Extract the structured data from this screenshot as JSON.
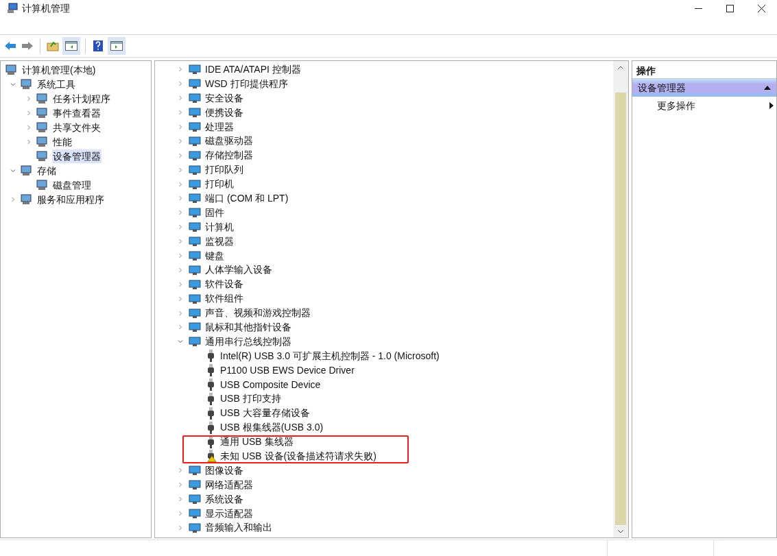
{
  "window": {
    "title": "计算机管理"
  },
  "nav_tree": [
    {
      "label": "计算机管理(本地)",
      "selected": false,
      "children": [
        {
          "label": "系统工具",
          "expanded": true,
          "selected": false,
          "children": [
            {
              "label": "任务计划程序",
              "expanded": false,
              "selected": false
            },
            {
              "label": "事件查看器",
              "expanded": false,
              "selected": false
            },
            {
              "label": "共享文件夹",
              "expanded": false,
              "selected": false
            },
            {
              "label": "性能",
              "expanded": false,
              "selected": false
            },
            {
              "label": "设备管理器",
              "selected": true
            }
          ]
        },
        {
          "label": "存储",
          "expanded": true,
          "selected": false,
          "children": [
            {
              "label": "磁盘管理",
              "selected": false
            }
          ]
        },
        {
          "label": "服务和应用程序",
          "expanded": false,
          "selected": false
        }
      ]
    }
  ],
  "device_tree": [
    {
      "label": "IDE ATA/ATAPI 控制器",
      "expanded": false
    },
    {
      "label": "WSD 打印提供程序",
      "expanded": false
    },
    {
      "label": "安全设备",
      "expanded": false
    },
    {
      "label": "便携设备",
      "expanded": false
    },
    {
      "label": "处理器",
      "expanded": false
    },
    {
      "label": "磁盘驱动器",
      "expanded": false
    },
    {
      "label": "存储控制器",
      "expanded": false
    },
    {
      "label": "打印队列",
      "expanded": false
    },
    {
      "label": "打印机",
      "expanded": false
    },
    {
      "label": "端口 (COM 和 LPT)",
      "expanded": false
    },
    {
      "label": "固件",
      "expanded": false
    },
    {
      "label": "计算机",
      "expanded": false
    },
    {
      "label": "监视器",
      "expanded": false
    },
    {
      "label": "键盘",
      "expanded": false
    },
    {
      "label": "人体学输入设备",
      "expanded": false
    },
    {
      "label": "软件设备",
      "expanded": false
    },
    {
      "label": "软件组件",
      "expanded": false
    },
    {
      "label": "声音、视频和游戏控制器",
      "expanded": false
    },
    {
      "label": "鼠标和其他指针设备",
      "expanded": false
    },
    {
      "label": "通用串行总线控制器",
      "expanded": true,
      "children": [
        {
          "label": "Intel(R) USB 3.0 可扩展主机控制器 - 1.0 (Microsoft)",
          "warning": false
        },
        {
          "label": "P1100 USB EWS Device Driver",
          "warning": false
        },
        {
          "label": "USB Composite Device",
          "warning": false
        },
        {
          "label": "USB 打印支持",
          "warning": false
        },
        {
          "label": "USB 大容量存储设备",
          "warning": false
        },
        {
          "label": "USB 根集线器(USB 3.0)",
          "warning": false
        },
        {
          "label": "通用 USB 集线器",
          "warning": false
        },
        {
          "label": "未知 USB 设备(设备描述符请求失败)",
          "warning": true
        }
      ]
    },
    {
      "label": "图像设备",
      "expanded": false
    },
    {
      "label": "网络适配器",
      "expanded": false
    },
    {
      "label": "系统设备",
      "expanded": false
    },
    {
      "label": "显示适配器",
      "expanded": false
    },
    {
      "label": "音频输入和输出",
      "expanded": false
    }
  ],
  "actions": {
    "title": "操作",
    "section": {
      "label": "设备管理器",
      "expanded": true
    },
    "items": [
      "更多操作"
    ]
  }
}
